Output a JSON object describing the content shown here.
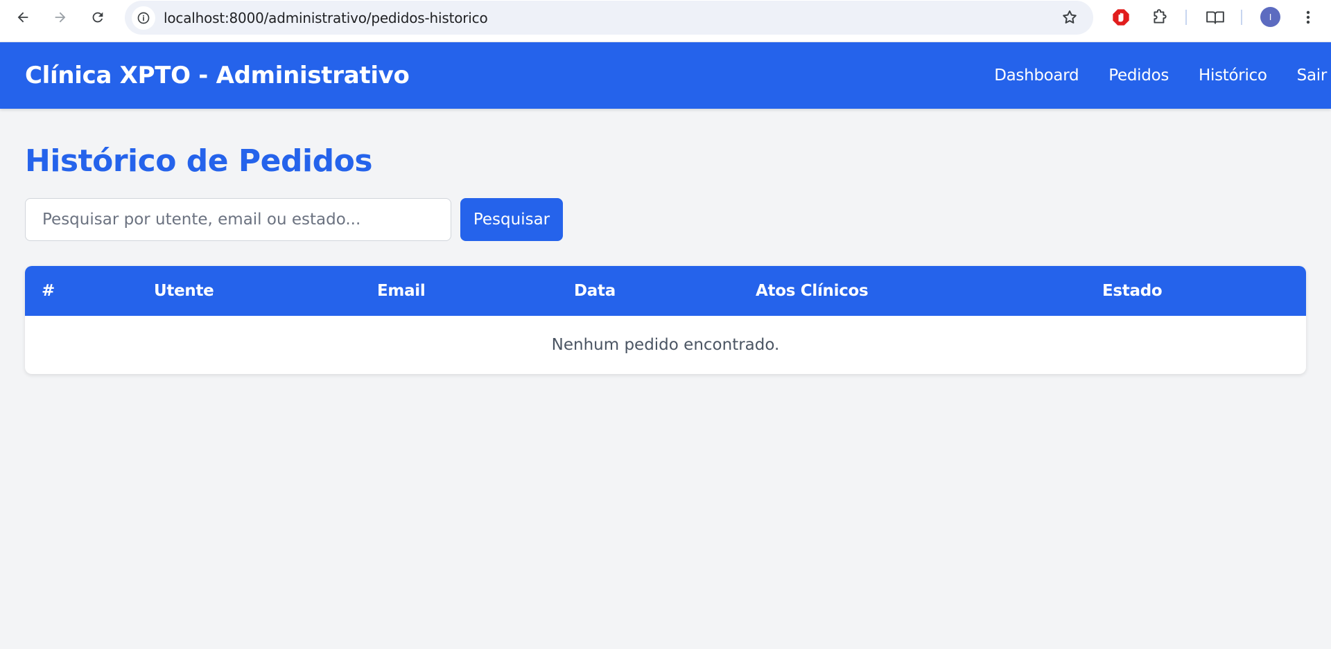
{
  "browser": {
    "url": "localhost:8000/administrativo/pedidos-historico",
    "avatar_initial": "I"
  },
  "header": {
    "title": "Clínica XPTO - Administrativo",
    "nav": [
      {
        "label": "Dashboard"
      },
      {
        "label": "Pedidos"
      },
      {
        "label": "Histórico"
      },
      {
        "label": "Sair"
      }
    ]
  },
  "main": {
    "title": "Histórico de Pedidos",
    "search": {
      "placeholder": "Pesquisar por utente, email ou estado...",
      "value": "",
      "button_label": "Pesquisar"
    },
    "table": {
      "columns": [
        "#",
        "Utente",
        "Email",
        "Data",
        "Atos Clínicos",
        "Estado"
      ],
      "empty_message": "Nenhum pedido encontrado."
    }
  },
  "colors": {
    "primary": "#2563eb",
    "background": "#f3f4f6",
    "card": "#ffffff"
  }
}
